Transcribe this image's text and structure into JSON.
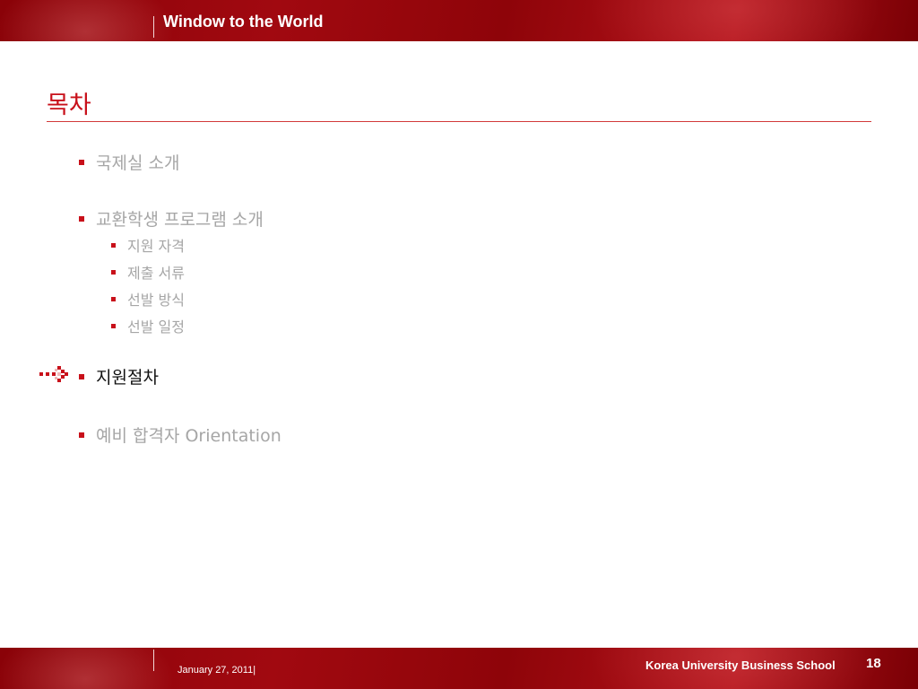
{
  "header": {
    "title": "Window to the World"
  },
  "slide": {
    "title": "목차",
    "outline": [
      {
        "label": "국제실 소개",
        "level": 1,
        "active": false
      },
      {
        "label": "교환학생 프로그램 소개",
        "level": 1,
        "active": false
      },
      {
        "label": "지원 자격",
        "level": 2,
        "active": false
      },
      {
        "label": "제출 서류",
        "level": 2,
        "active": false
      },
      {
        "label": "선발 방식",
        "level": 2,
        "active": false
      },
      {
        "label": "선발 일정",
        "level": 2,
        "active": false
      },
      {
        "label": "지원절차",
        "level": 1,
        "active": true
      },
      {
        "label": "예비 합격자 Orientation",
        "level": 1,
        "active": false
      }
    ],
    "current_marker_icon": "dotted-arrow-icon"
  },
  "footer": {
    "date": "January 27, 2011|",
    "school": "Korea University Business School",
    "page_number": "18"
  },
  "colors": {
    "brand_red": "#c8101a",
    "band_dark": "#8a0208",
    "inactive_text": "#a6a6a6",
    "active_text": "#111111"
  }
}
